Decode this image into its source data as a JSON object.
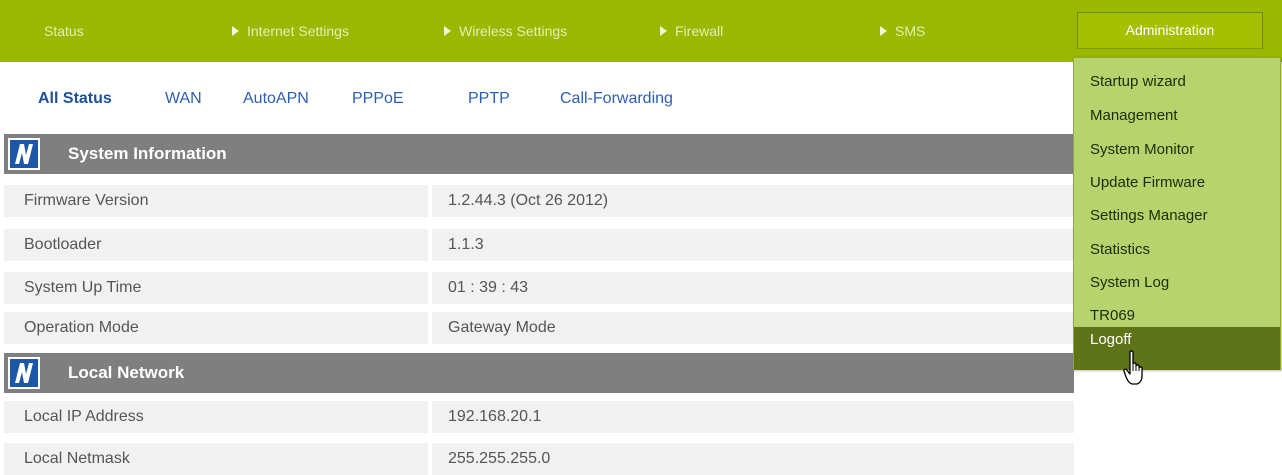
{
  "topnav": {
    "items": [
      {
        "label": "Status",
        "arrow": false
      },
      {
        "label": "Internet Settings",
        "arrow": true
      },
      {
        "label": "Wireless Settings",
        "arrow": true
      },
      {
        "label": "Firewall",
        "arrow": true
      },
      {
        "label": "SMS",
        "arrow": true
      }
    ],
    "active_label": "Administration"
  },
  "subnav": {
    "items": [
      "All Status",
      "WAN",
      "AutoAPN",
      "PPPoE",
      "PPTP",
      "Call-Forwarding"
    ]
  },
  "sections": {
    "system": {
      "title": "System Information",
      "rows": [
        {
          "label": "Firmware Version",
          "value": "1.2.44.3 (Oct 26 2012)"
        },
        {
          "label": "Bootloader",
          "value": "1.1.3"
        },
        {
          "label": "System Up Time",
          "value": "01 : 39 : 43"
        },
        {
          "label": "Operation Mode",
          "value": "Gateway Mode"
        }
      ]
    },
    "local": {
      "title": "Local Network",
      "rows": [
        {
          "label": "Local IP Address",
          "value": "192.168.20.1"
        },
        {
          "label": "Local Netmask",
          "value": "255.255.255.0"
        }
      ]
    }
  },
  "admin_menu": {
    "items": [
      "Startup wizard",
      "Management",
      "System Monitor",
      "Update Firmware",
      "Settings Manager",
      "Statistics",
      "System Log",
      "TR069",
      "Logoff"
    ],
    "hovered": "Logoff"
  },
  "colors": {
    "nav_bg": "#9ab800",
    "dropdown_bg": "#b7d36e",
    "dropdown_hover": "#5f7319",
    "section_bg": "#7f7f7f",
    "link": "#2a5fb4",
    "logo_blue": "#1b56a8"
  },
  "icons": {
    "section_logo": "brand-logo-icon",
    "nav_arrow": "triangle-right-icon",
    "cursor": "hand-pointer-icon"
  }
}
